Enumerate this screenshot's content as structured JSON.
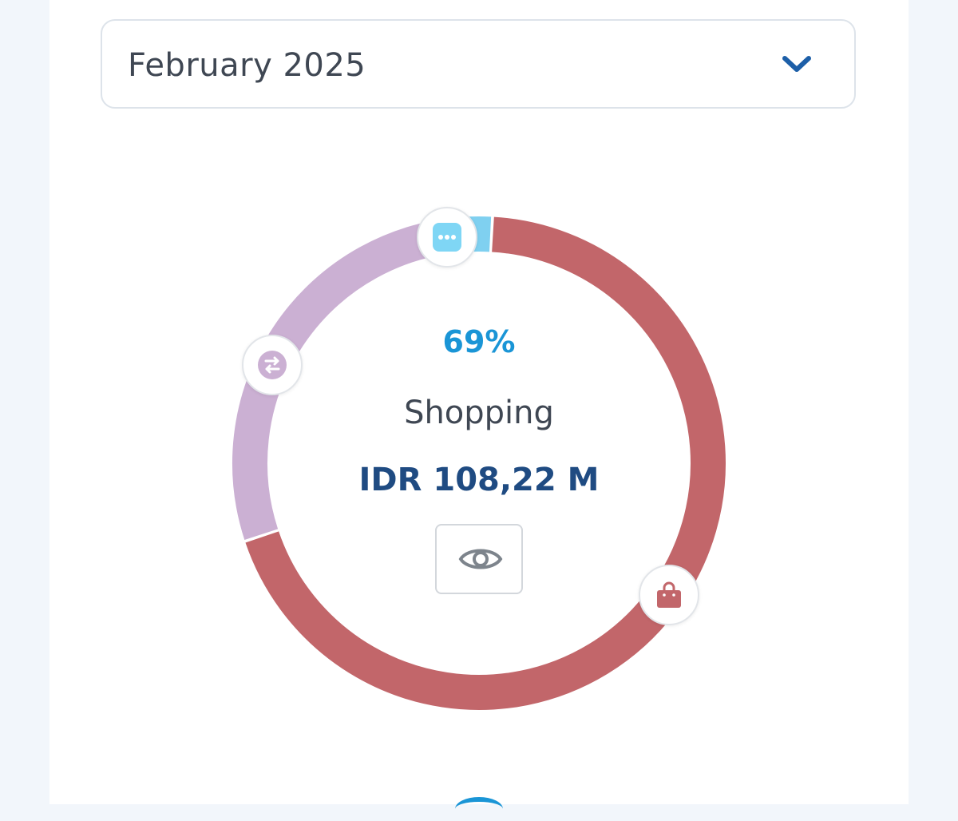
{
  "period_selector": {
    "selected_label": "February 2025",
    "icon": "chevron-down-icon"
  },
  "chart_data": {
    "type": "pie",
    "style": "donut",
    "highlighted": {
      "percent_label": "69%",
      "category": "Shopping",
      "amount": "IDR 108,22 M"
    },
    "slices": [
      {
        "category": "Shopping",
        "fraction": 0.69,
        "color": "#c2666a",
        "icon": "shopping-bag-icon"
      },
      {
        "category": "Transfer",
        "fraction": 0.29,
        "color": "#cbb0d3",
        "icon": "transfer-icon"
      },
      {
        "category": "Others",
        "fraction": 0.02,
        "color": "#7fd0f0",
        "icon": "more-dots-icon"
      }
    ]
  },
  "actions": {
    "toggle_visibility_icon": "eye-icon"
  },
  "colors": {
    "accent_blue": "#1a95d6",
    "amount_navy": "#1f4b82",
    "chevron_blue": "#1d5fa8"
  }
}
